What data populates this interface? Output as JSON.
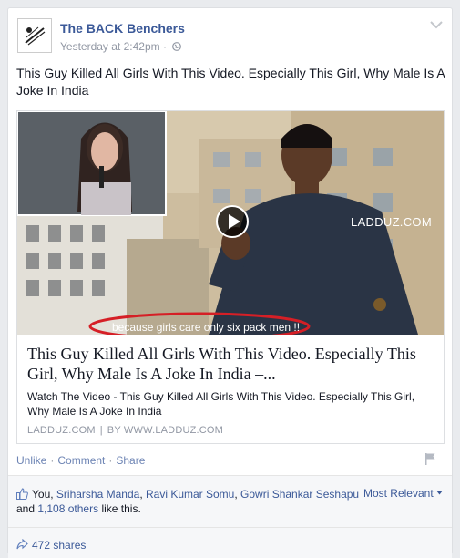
{
  "post": {
    "page_name": "The BACK Benchers",
    "timestamp": "Yesterday at 2:42pm",
    "meta_separator": "·",
    "text": "This Guy Killed All Girls With This Video. Especially This Girl, Why Male Is A Joke In India"
  },
  "link_preview": {
    "watermark": "LADDUZ.COM",
    "caption": "because girls care only six pack men !!",
    "title": "This Guy Killed All Girls With This Video. Especially This Girl, Why Male Is A Joke In India –...",
    "description": "Watch The Video - This Guy Killed All Girls With This Video. Especially This Girl, Why Male Is A Joke In India",
    "source_domain": "LADDUZ.COM",
    "source_separator": "|",
    "source_author": "BY WWW.LADDUZ.COM"
  },
  "actions": {
    "unlike": "Unlike",
    "comment": "Comment",
    "share": "Share",
    "separator": "·"
  },
  "ufi": {
    "likers": [
      "You",
      "Sriharsha Manda",
      "Ravi Kumar Somu",
      "Gowri Shankar Seshapu"
    ],
    "and_text": "and",
    "others_text": "1,108 others",
    "like_suffix": "like this.",
    "sort_label": "Most Relevant",
    "shares_text": "472 shares"
  },
  "colors": {
    "link_blue": "#3b5998",
    "action_blue": "#6d84b4",
    "meta_gray": "#9197a3",
    "background": "#e9ebee",
    "ufi_background": "#f6f7f9"
  },
  "icons": [
    "page-logo-icon",
    "globe-icon",
    "chevron-down-icon",
    "play-icon",
    "flag-icon",
    "like-thumb-icon",
    "share-arrow-icon",
    "caret-down-icon"
  ]
}
